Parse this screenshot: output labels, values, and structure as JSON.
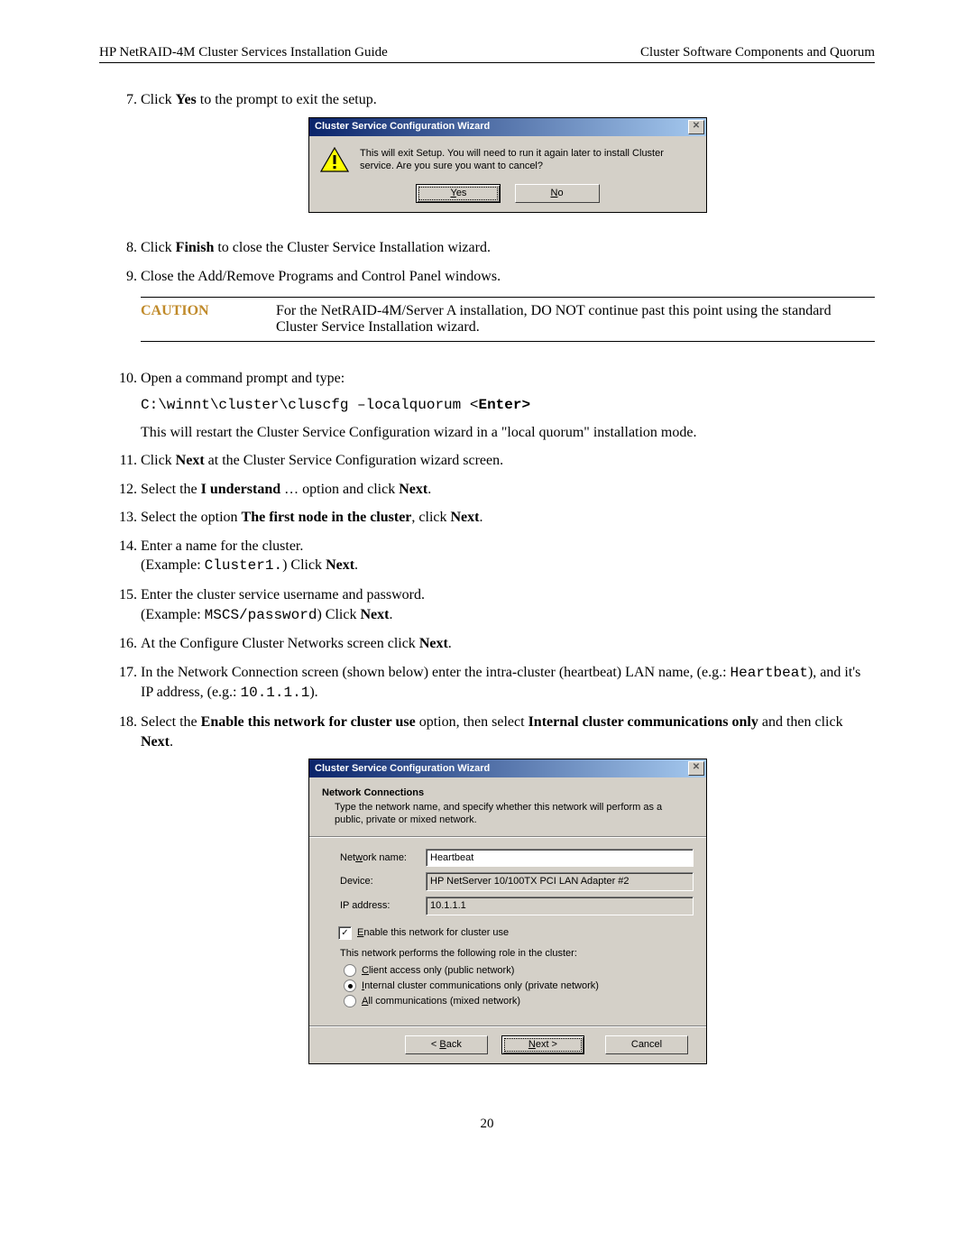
{
  "header": {
    "left": "HP NetRAID-4M Cluster Services Installation Guide",
    "right": "Cluster Software Components and Quorum"
  },
  "steps": {
    "s7_a": "Click ",
    "s7_b": "Yes",
    "s7_c": " to the prompt to exit the setup.",
    "s8_a": "Click ",
    "s8_b": "Finish",
    "s8_c": " to close the Cluster Service Installation wizard.",
    "s9": "Close the Add/Remove Programs and Control Panel windows.",
    "s10": "Open a command prompt and type:",
    "s10_cmd": "C:\\winnt\\cluster\\cluscfg –localquorum <",
    "s10_cmd_bold": "Enter>",
    "s10_text": "This will restart the Cluster Service Configuration wizard in a \"local quorum\" installation mode.",
    "s11_a": "Click ",
    "s11_b": "Next",
    "s11_c": " at the Cluster Service Configuration wizard screen.",
    "s12_a": "Select the ",
    "s12_b": "I understand",
    "s12_c": " … option and click ",
    "s12_d": "Next",
    "s12_e": ".",
    "s13_a": "Select the option ",
    "s13_b": "The first node in the cluster",
    "s13_c": ", click ",
    "s13_d": "Next",
    "s13_e": ".",
    "s14_a": "Enter a name for the cluster.",
    "s14_b": "(Example: ",
    "s14_c": "Cluster1.",
    "s14_d": ") Click ",
    "s14_e": "Next",
    "s14_f": ".",
    "s15_a": "Enter the cluster service username and password.",
    "s15_b": "(Example: ",
    "s15_c": "MSCS/password",
    "s15_d": ") Click ",
    "s15_e": "Next",
    "s15_f": ".",
    "s16_a": "At the Configure Cluster Networks screen click ",
    "s16_b": "Next",
    "s16_c": ".",
    "s17_a": "In the Network Connection screen (shown below) enter the intra-cluster (heartbeat) LAN name, (e.g.: ",
    "s17_b": "Heartbeat",
    "s17_c": "), and it's IP address, (e.g.: ",
    "s17_d": "10.1.1.1",
    "s17_e": ").",
    "s18_a": "Select the ",
    "s18_b": "Enable this network for cluster use",
    "s18_c": " option, then select ",
    "s18_d": "Internal cluster communications only",
    "s18_e": " and then click ",
    "s18_f": "Next",
    "s18_g": "."
  },
  "caution": {
    "label": "CAUTION",
    "text": "For the NetRAID-4M/Server A installation, DO NOT continue past this point using the standard Cluster Service Installation wizard."
  },
  "dlg1": {
    "title": "Cluster Service Configuration Wizard",
    "msg": "This will exit Setup. You will need to run it again later to install Cluster service. Are you sure you want to cancel?",
    "yes": "Yes",
    "no": "No"
  },
  "dlg2": {
    "title": "Cluster Service Configuration Wizard",
    "heading": "Network Connections",
    "sub": "Type the network name, and specify whether this network will perform as a public, private or mixed network.",
    "lbl_net": "Network name:",
    "val_net": "Heartbeat",
    "lbl_dev": "Device:",
    "val_dev": "HP NetServer 10/100TX PCI LAN Adapter #2",
    "lbl_ip": "IP address:",
    "val_ip": "10.1.1.1",
    "chk": "Enable this network for cluster use",
    "role_text": "This network performs the following role in the cluster:",
    "r1": "Client access only (public network)",
    "r2": "Internal cluster communications only (private network)",
    "r3": "All communications (mixed network)",
    "back": "< Back",
    "next": "Next >",
    "cancel": "Cancel"
  },
  "page_number": "20"
}
